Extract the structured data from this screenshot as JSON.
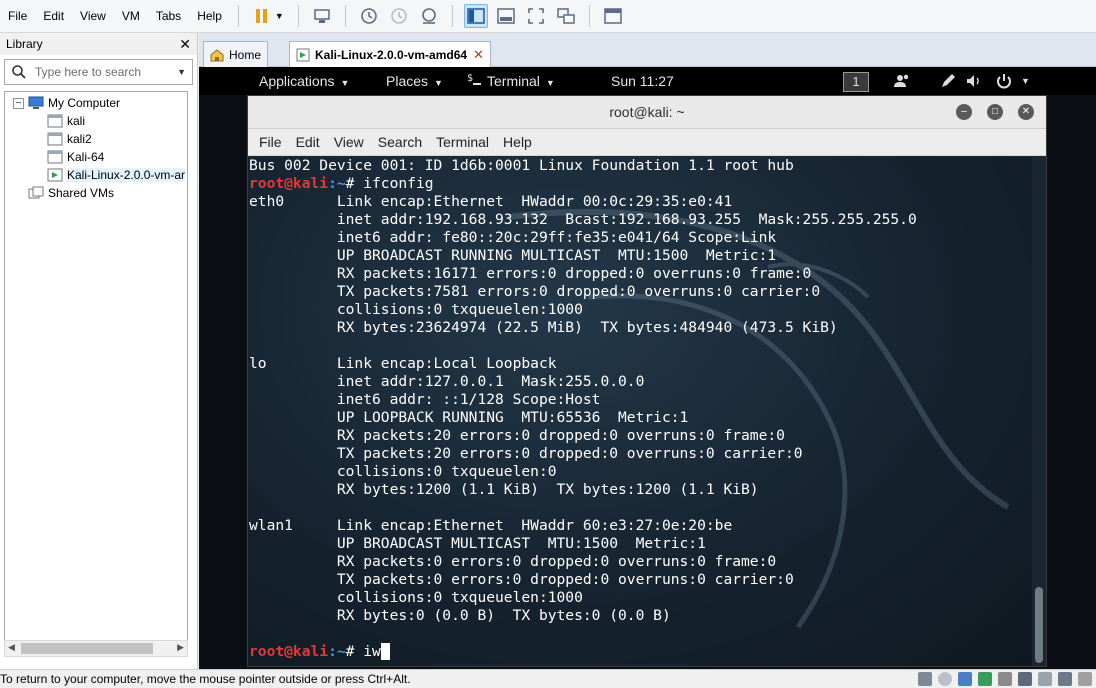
{
  "menubar": {
    "items": [
      "File",
      "Edit",
      "View",
      "VM",
      "Tabs",
      "Help"
    ]
  },
  "library": {
    "title": "Library",
    "search_placeholder": "Type here to search",
    "tree": {
      "root": "My Computer",
      "children": [
        "kali",
        "kali2",
        "Kali-64",
        "Kali-Linux-2.0.0-vm-ar"
      ],
      "shared": "Shared VMs"
    }
  },
  "tabs": [
    {
      "label": "Home"
    },
    {
      "label": "Kali-Linux-2.0.0-vm-amd64"
    }
  ],
  "gnome": {
    "applications": "Applications",
    "places": "Places",
    "terminal": "Terminal",
    "clock": "Sun 11:27",
    "workspace": "1"
  },
  "terminal": {
    "title": "root@kali: ~",
    "menu": [
      "File",
      "Edit",
      "View",
      "Search",
      "Terminal",
      "Help"
    ],
    "prompt_user": "root@kali",
    "prompt_path": ":~",
    "prompt_symbol": "# ",
    "lines": [
      "Bus 002 Device 001: ID 1d6b:0001 Linux Foundation 1.1 root hub",
      "eth0      Link encap:Ethernet  HWaddr 00:0c:29:35:e0:41",
      "          inet addr:192.168.93.132  Bcast:192.168.93.255  Mask:255.255.255.0",
      "          inet6 addr: fe80::20c:29ff:fe35:e041/64 Scope:Link",
      "          UP BROADCAST RUNNING MULTICAST  MTU:1500  Metric:1",
      "          RX packets:16171 errors:0 dropped:0 overruns:0 frame:0",
      "          TX packets:7581 errors:0 dropped:0 overruns:0 carrier:0",
      "          collisions:0 txqueuelen:1000",
      "          RX bytes:23624974 (22.5 MiB)  TX bytes:484940 (473.5 KiB)",
      "",
      "lo        Link encap:Local Loopback",
      "          inet addr:127.0.0.1  Mask:255.0.0.0",
      "          inet6 addr: ::1/128 Scope:Host",
      "          UP LOOPBACK RUNNING  MTU:65536  Metric:1",
      "          RX packets:20 errors:0 dropped:0 overruns:0 frame:0",
      "          TX packets:20 errors:0 dropped:0 overruns:0 carrier:0",
      "          collisions:0 txqueuelen:0",
      "          RX bytes:1200 (1.1 KiB)  TX bytes:1200 (1.1 KiB)",
      "",
      "wlan1     Link encap:Ethernet  HWaddr 60:e3:27:0e:20:be",
      "          UP BROADCAST MULTICAST  MTU:1500  Metric:1",
      "          RX packets:0 errors:0 dropped:0 overruns:0 frame:0",
      "          TX packets:0 errors:0 dropped:0 overruns:0 carrier:0",
      "          collisions:0 txqueuelen:1000",
      "          RX bytes:0 (0.0 B)  TX bytes:0 (0.0 B)",
      ""
    ],
    "command_1": "ifconfig",
    "command_2": "iw"
  },
  "statusbar": {
    "text": "To return to your computer, move the mouse pointer outside or press Ctrl+Alt."
  },
  "colors": {
    "prompt_user": "#e23a3a",
    "prompt_path": "#5f8fe0",
    "terminal_bg": "#15222e"
  },
  "icons": [
    "pause-icon",
    "send-ctrl-alt-del-icon",
    "snapshot-icon",
    "revert-snapshot-icon",
    "snapshot-manager-icon",
    "library-view-icon",
    "console-view-icon",
    "fullscreen-icon",
    "unity-icon",
    "thumbnail-icon",
    "search-icon",
    "computer-icon",
    "vm-icon",
    "home-icon",
    "tab-vm-icon",
    "terminal-app-icon",
    "users-icon",
    "pen-icon",
    "volume-icon",
    "power-icon"
  ]
}
